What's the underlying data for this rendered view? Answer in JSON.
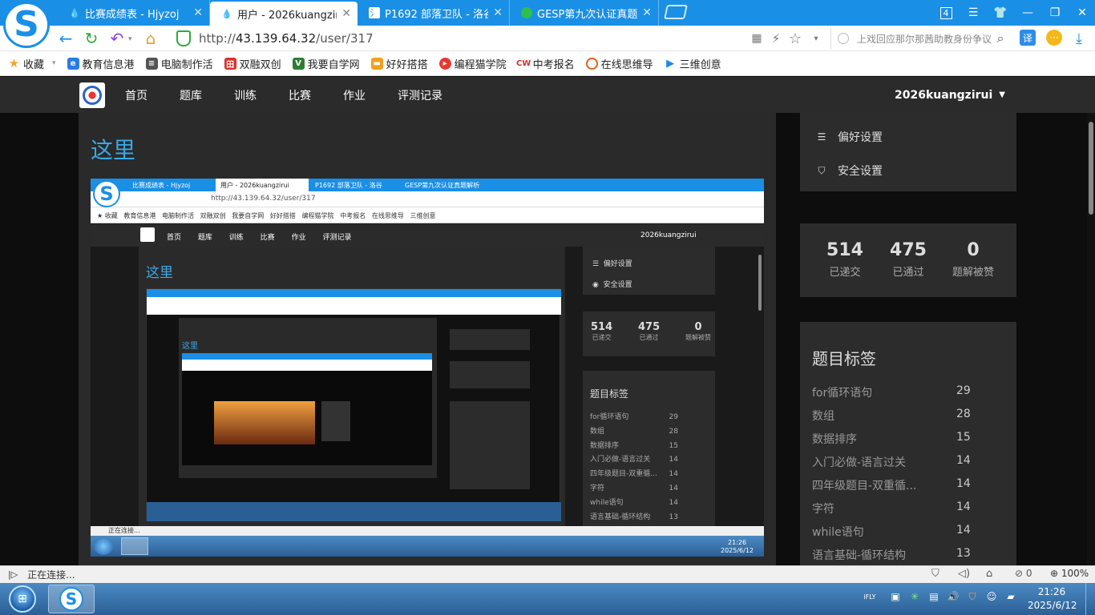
{
  "browser": {
    "tabs": [
      {
        "title": "比赛成绩表 - Hjyzoj",
        "active": false
      },
      {
        "title": "用户 - 2026kuangzirui",
        "active": true
      },
      {
        "title": "P1692 部落卫队 - 洛谷",
        "active": false
      },
      {
        "title": "GESP第九次认证真题解析",
        "active": false
      }
    ],
    "tab_counter": "4",
    "url_prefix": "http://",
    "url_host": "43.139.64.32",
    "url_path": "/user/317",
    "search_placeholder": "上戏回应那尔那茜助教身份争议",
    "bookmarks": [
      {
        "label": "收藏",
        "icon": "star-icon",
        "color": "#f5a623"
      },
      {
        "label": "教育信息港",
        "icon": "edu-icon",
        "color": "#2a7be4"
      },
      {
        "label": "电脑制作活",
        "icon": "doc-icon",
        "color": "#555555"
      },
      {
        "label": "双融双创",
        "icon": "grid-icon",
        "color": "#d9322b"
      },
      {
        "label": "我要自学网",
        "icon": "v-icon",
        "color": "#2e7d32"
      },
      {
        "label": "好好搭搭",
        "icon": "folder-icon",
        "color": "#f0a020"
      },
      {
        "label": "编程猫学院",
        "icon": "cat-icon",
        "color": "#e53935"
      },
      {
        "label": "中考报名",
        "icon": "cw-icon",
        "color": "#d32f2f"
      },
      {
        "label": "在线思维导",
        "icon": "mind-icon",
        "color": "#e06020"
      },
      {
        "label": "三维创意",
        "icon": "play-icon",
        "color": "#1e88e5"
      }
    ],
    "status_text": "正在连接...",
    "zoom": "100%",
    "download_count": "0"
  },
  "site": {
    "nav": [
      "首页",
      "题库",
      "训练",
      "比赛",
      "作业",
      "评测记录"
    ],
    "username": "2026kuangzirui",
    "heading": "这里",
    "menu": [
      {
        "label": "偏好设置",
        "icon": "sliders-icon"
      },
      {
        "label": "安全设置",
        "icon": "shield-icon"
      }
    ],
    "stats": [
      {
        "value": "514",
        "label": "已递交"
      },
      {
        "value": "475",
        "label": "已通过"
      },
      {
        "value": "0",
        "label": "题解被赞"
      }
    ],
    "tags_title": "题目标签",
    "tags": [
      {
        "name": "for循环语句",
        "count": "29"
      },
      {
        "name": "数组",
        "count": "28"
      },
      {
        "name": "数据排序",
        "count": "15"
      },
      {
        "name": "入门必做-语言过关",
        "count": "14"
      },
      {
        "name": "四年级题目-双重循...",
        "count": "14"
      },
      {
        "name": "字符",
        "count": "14"
      },
      {
        "name": "while语句",
        "count": "14"
      },
      {
        "name": "语言基础-循环结构",
        "count": "13"
      }
    ],
    "mini_tags_full": [
      {
        "name": "for循环语句",
        "count": "29"
      },
      {
        "name": "数组",
        "count": "28"
      },
      {
        "name": "数据排序",
        "count": "15"
      },
      {
        "name": "入门必做-语言过关",
        "count": "14"
      },
      {
        "name": "四年级题目-双重循...",
        "count": "14"
      },
      {
        "name": "字符",
        "count": "14"
      },
      {
        "name": "while语句",
        "count": "14"
      },
      {
        "name": "语言基础-循环结构",
        "count": "13"
      }
    ]
  },
  "taskbar": {
    "time": "21:26",
    "date": "2025/6/12",
    "mini_time": "21:26",
    "mini_date": "2025/6/12"
  }
}
